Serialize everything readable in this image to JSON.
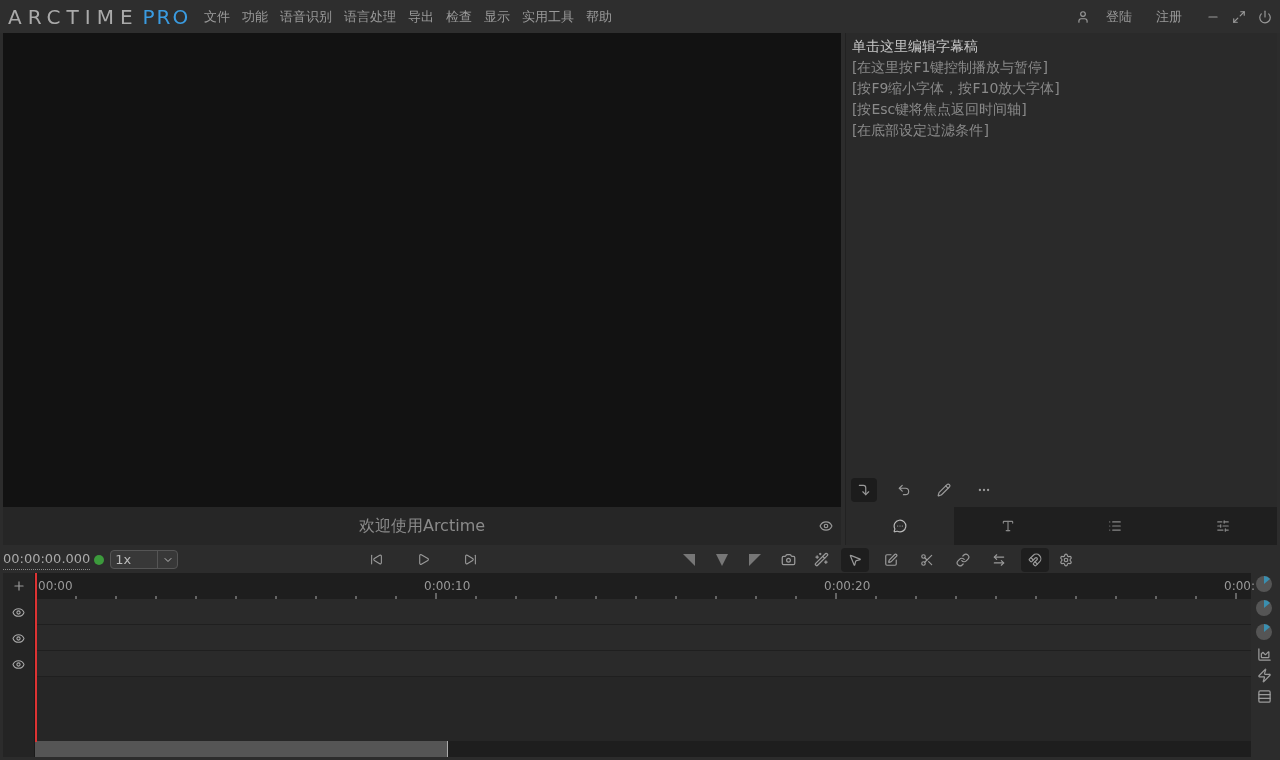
{
  "logo": {
    "name": "ARCTIME",
    "edition": "PRO"
  },
  "menu": [
    "文件",
    "功能",
    "语音识别",
    "语言处理",
    "导出",
    "检查",
    "显示",
    "实用工具",
    "帮助"
  ],
  "account": [
    "登陆",
    "注册"
  ],
  "video": {
    "caption": "欢迎使用Arctime"
  },
  "editor": {
    "lines": [
      "单击这里编辑字幕稿",
      "[在这里按F1键控制播放与暂停]",
      "[按F9缩小字体，按F10放大字体]",
      "[按Esc键将焦点返回时间轴]",
      "[在底部设定过滤条件]"
    ]
  },
  "editor_tools": [
    {
      "kind": "insert",
      "selected": true
    },
    {
      "kind": "undo",
      "selected": false
    },
    {
      "kind": "pencil",
      "selected": false
    },
    {
      "kind": "more",
      "selected": false
    }
  ],
  "panel_tabs": [
    {
      "kind": "chat",
      "selected": true
    },
    {
      "kind": "font",
      "selected": false
    },
    {
      "kind": "list",
      "selected": false
    },
    {
      "kind": "sliders",
      "selected": false
    }
  ],
  "transport": {
    "time": "00:00:00.000",
    "speed": "1x",
    "status": {
      "color": "#3c9a3c"
    }
  },
  "tools": [
    {
      "kind": "pointer",
      "selected": true
    },
    {
      "kind": "edit",
      "selected": false
    },
    {
      "kind": "scissors",
      "selected": false
    },
    {
      "kind": "link",
      "selected": false
    },
    {
      "kind": "swap",
      "selected": false
    },
    {
      "kind": "magnet",
      "selected": true
    }
  ],
  "timeline": {
    "ticks": [
      "00:00",
      "0:00:10",
      "0:00:20",
      "0:00:"
    ],
    "tracks": [
      {
        "visible": true
      },
      {
        "visible": true
      },
      {
        "visible": true
      }
    ],
    "scroll": {
      "level": 0.34
    }
  }
}
